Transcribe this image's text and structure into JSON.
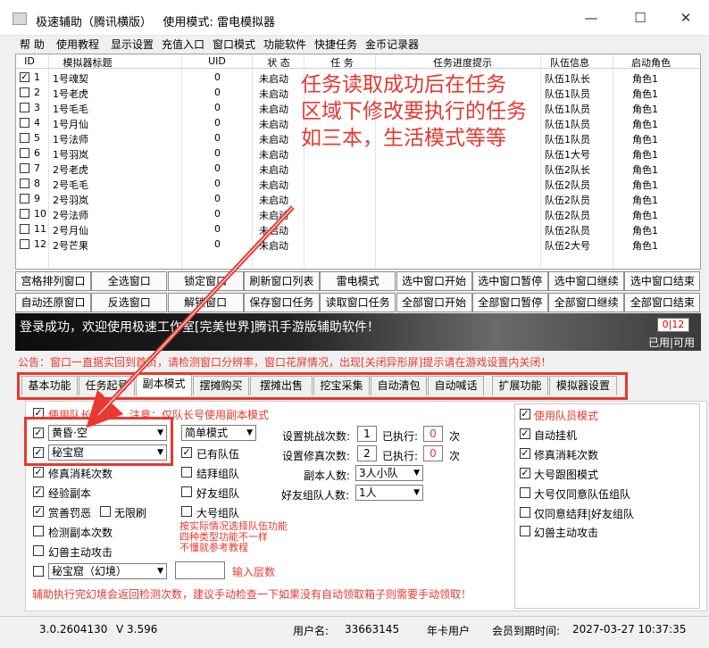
{
  "window": {
    "title": "极速辅助（腾讯横版）",
    "mode_label": "使用模式:",
    "mode_value": "雷电模拟器",
    "controls": {
      "minimize": "—",
      "maximize": "☐",
      "close": "✕"
    }
  },
  "menu": [
    "帮 助",
    "使用教程",
    "显示设置",
    "充值入口",
    "窗口模式",
    "功能软件",
    "快捷任务",
    "金币记录器"
  ],
  "table": {
    "headers": [
      "ID",
      "模拟器标题",
      "UID",
      "状 态",
      "任 务",
      "任务进度提示",
      "队伍信息",
      "启动角色"
    ],
    "rows": [
      {
        "checked": "✓",
        "id": "1",
        "title": "1号魂契",
        "uid": "0",
        "status": "未启动",
        "team": "队伍1队长",
        "role": "角色1"
      },
      {
        "checked": "",
        "id": "2",
        "title": "1号老虎",
        "uid": "0",
        "status": "未启动",
        "team": "队伍1队员",
        "role": "角色1"
      },
      {
        "checked": "",
        "id": "3",
        "title": "1号毛毛",
        "uid": "0",
        "status": "未启动",
        "team": "队伍1队员",
        "role": "角色1"
      },
      {
        "checked": "",
        "id": "4",
        "title": "1号月仙",
        "uid": "0",
        "status": "未启动",
        "team": "队伍1队员",
        "role": "角色1"
      },
      {
        "checked": "",
        "id": "5",
        "title": "1号法师",
        "uid": "0",
        "status": "未启动",
        "team": "队伍1队员",
        "role": "角色1"
      },
      {
        "checked": "",
        "id": "6",
        "title": "1号羽岚",
        "uid": "0",
        "status": "未启动",
        "team": "队伍1大号",
        "role": "角色1"
      },
      {
        "checked": "",
        "id": "7",
        "title": "2号老虎",
        "uid": "0",
        "status": "未启动",
        "team": "队伍2队长",
        "role": "角色1"
      },
      {
        "checked": "",
        "id": "8",
        "title": "2号毛毛",
        "uid": "0",
        "status": "未启动",
        "team": "队伍2队员",
        "role": "角色1"
      },
      {
        "checked": "",
        "id": "9",
        "title": "2号羽岚",
        "uid": "0",
        "status": "未启动",
        "team": "队伍2队员",
        "role": "角色1"
      },
      {
        "checked": "",
        "id": "10",
        "title": "2号法师",
        "uid": "0",
        "status": "未启动",
        "team": "队伍2队员",
        "role": "角色1"
      },
      {
        "checked": "",
        "id": "11",
        "title": "2号月仙",
        "uid": "0",
        "status": "未启动",
        "team": "队伍2队员",
        "role": "角色1"
      },
      {
        "checked": "",
        "id": "12",
        "title": "2号芒果",
        "uid": "0",
        "status": "未启动",
        "team": "队伍2大号",
        "role": "角色1"
      }
    ]
  },
  "annotation": {
    "lines": [
      "任务读取成功后在任务",
      "区域下修改要执行的任务",
      "如三本，生活模式等等"
    ],
    "color": "#e8382f"
  },
  "buttons_row1": [
    "宫格排列窗口",
    "全选窗口",
    "锁定窗口",
    "刷新窗口列表",
    "雷电模式",
    "选中窗口开始",
    "选中窗口暂停",
    "选中窗口继续",
    "选中窗口结束"
  ],
  "buttons_row2": [
    "自动还原窗口",
    "反选窗口",
    "解锁窗口",
    "保存窗口任务",
    "读取窗口任务",
    "全部窗口开始",
    "全部窗口暂停",
    "全部窗口继续",
    "全部窗口结束"
  ],
  "banner": {
    "text": "登录成功，欢迎使用极速工作室[完美世界]腾讯手游版辅助软件！",
    "counter": "0|12",
    "used_label": "已用|可用"
  },
  "notice": "公告：窗口一直据实回到首页，请检测窗口分辨率，窗口花屏情况，出现[关闭异形屏]提示请在游戏设置内关闭！",
  "tabs": [
    "基本功能",
    "任务起号",
    "副本模式",
    "摆摊购买",
    "摆摊出售",
    "挖宝采集",
    "自动清包",
    "自动喊话",
    "扩展功能",
    "模拟器设置"
  ],
  "active_tab": "副本模式",
  "dungeon": {
    "use_leader_mode": {
      "label": "使用队长模式",
      "checked": "✓"
    },
    "note": "注意：仅队长号使用副本模式",
    "dungeon1": {
      "checked": "✓",
      "value": "黄昏·空"
    },
    "dungeon2": {
      "checked": "✓",
      "value": "秘宝窟"
    },
    "difficulty": "简单模式",
    "has_team": {
      "label": "已有队伍",
      "checked": "✓"
    },
    "form_team": {
      "label": "结拜组队",
      "checked": ""
    },
    "friend_team": {
      "label": "好友组队",
      "checked": ""
    },
    "big_team": {
      "label": "大号组队",
      "checked": ""
    },
    "repair_consume": {
      "label": "修真消耗次数",
      "checked": "✓"
    },
    "exp_dungeon": {
      "label": "经验副本",
      "checked": "✓"
    },
    "reward": {
      "label": "赏善罚恶",
      "checked": "✓"
    },
    "unlimited": {
      "label": "无限刷",
      "checked": ""
    },
    "detect_count": {
      "label": "检测副本次数",
      "checked": ""
    },
    "pet_attack": {
      "label": "幻兽主动攻击",
      "checked": ""
    },
    "illusion": {
      "checked": "",
      "value": "秘宝窟（幻境）"
    },
    "floors_label": "输入层数",
    "challenge_label": "设置挑战次数:",
    "challenge_value": "1",
    "executed_label": "已执行:",
    "challenge_exec": "0",
    "times": "次",
    "repair_label": "设置修真次数:",
    "repair_value": "2",
    "repair_exec": "0",
    "people_label": "副本人数:",
    "people_value": "3人小队",
    "friend_people_label": "好友组队人数:",
    "friend_people_value": "1人",
    "hint": "按实际情况选择队伍功能\n四种类型功能不一样\n不懂就参考教程",
    "footer_note": "辅助执行完幻境会返回检测次数，建议手动检查一下如果没有自动领取箱子则需要手动领取！"
  },
  "member": {
    "use_member_mode": {
      "label": "使用队员模式",
      "checked": "✓"
    },
    "auto_hangup": {
      "label": "自动挂机",
      "checked": "✓"
    },
    "repair_consume": {
      "label": "修真消耗次数",
      "checked": "✓"
    },
    "big_follow": {
      "label": "大号跟图模式",
      "checked": "✓"
    },
    "big_agree": {
      "label": "大号仅同意队伍组队",
      "checked": ""
    },
    "agree_friends": {
      "label": "仅同意结拜|好友组队",
      "checked": ""
    },
    "pet_attack": {
      "label": "幻兽主动攻击",
      "checked": ""
    }
  },
  "status": {
    "version": "3.0.2604130",
    "v": "V 3.596",
    "user_label": "用户名:",
    "user_value": "33663145",
    "plan": "年卡用户",
    "expire_label": "会员到期时间:",
    "expire_value": "2027-03-27  10:37:35"
  }
}
